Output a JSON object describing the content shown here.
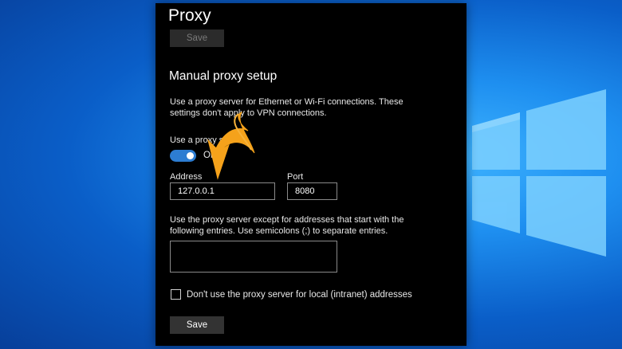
{
  "panel": {
    "title": "Proxy",
    "save_top_label": "Save",
    "section_heading": "Manual proxy setup",
    "description": "Use a proxy server for Ethernet or Wi-Fi connections. These settings don't apply to VPN connections.",
    "use_proxy_label": "Use a proxy server",
    "toggle_state": "On",
    "address_label": "Address",
    "address_value": "127.0.0.1",
    "port_label": "Port",
    "port_value": "8080",
    "exceptions_description": "Use the proxy server except for addresses that start with the following entries. Use semicolons (;) to separate entries.",
    "exceptions_value": "",
    "local_checkbox_label": "Don't use the proxy server for local (intranet) addresses",
    "save_bottom_label": "Save"
  },
  "colors": {
    "panel_bg": "#000000",
    "toggle_on": "#2d7dd2",
    "annotation_arrow": "#f5a21b",
    "desktop_blue": "#1e8ff0"
  },
  "icons": {
    "desktop_logo": "windows-logo-icon",
    "annotation": "curved-arrow-icon"
  }
}
